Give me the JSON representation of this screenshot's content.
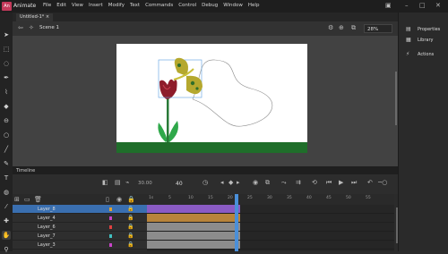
{
  "app": {
    "name": "Animate",
    "logo_text": "An"
  },
  "menu": [
    "File",
    "Edit",
    "View",
    "Insert",
    "Modify",
    "Text",
    "Commands",
    "Control",
    "Debug",
    "Window",
    "Help"
  ],
  "document_tab": "Untitled-1* ×",
  "scene": {
    "label": "Scene 1",
    "zoom": "28%"
  },
  "right_panel": {
    "items": [
      "Properties",
      "Library",
      "Actions"
    ]
  },
  "timeline": {
    "title": "Timeline",
    "fps": "30.00",
    "frame": "40",
    "ruler": [
      "1s",
      "5",
      "10",
      "15",
      "20",
      "25",
      "30",
      "35",
      "40",
      "45",
      "50",
      "55"
    ],
    "layers": [
      {
        "name": "Layer_8",
        "color": "#e0a030",
        "selected": true
      },
      {
        "name": "Layer_4",
        "color": "#c844c8",
        "selected": false
      },
      {
        "name": "Layer_6",
        "color": "#e04040",
        "selected": false
      },
      {
        "name": "Layer_7",
        "color": "#40c0c0",
        "selected": false
      },
      {
        "name": "Layer_3",
        "color": "#c844c8",
        "selected": false
      }
    ]
  },
  "colors": {
    "accent": "#4a8fd9",
    "stage_bg": "#ffffff",
    "ground": "#1f6e2a",
    "tween_purple": "#8a5bc4",
    "tween_orange": "#b8843a",
    "frames_gray": "#8c8c8c"
  }
}
